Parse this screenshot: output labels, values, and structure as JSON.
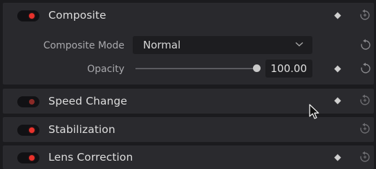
{
  "colors": {
    "background": "#1b1b1e",
    "section": "#2a2a2e",
    "accent_red": "#e8322c",
    "text": "#dedede",
    "label": "#a9a9ad"
  },
  "sections": {
    "composite": {
      "title": "Composite",
      "enabled": true,
      "composite_mode": {
        "label": "Composite Mode",
        "value": "Normal"
      },
      "opacity": {
        "label": "Opacity",
        "value": "100.00",
        "level": 1.0
      }
    },
    "speed_change": {
      "title": "Speed Change",
      "enabled": false
    },
    "stabilization": {
      "title": "Stabilization",
      "enabled": true
    },
    "lens_correction": {
      "title": "Lens Correction",
      "enabled": true
    }
  },
  "icons": {
    "keyframe": "diamond-icon",
    "reset": "reset-icon",
    "dropdown": "chevron-down-icon",
    "cursor": "mouse-pointer-icon"
  }
}
